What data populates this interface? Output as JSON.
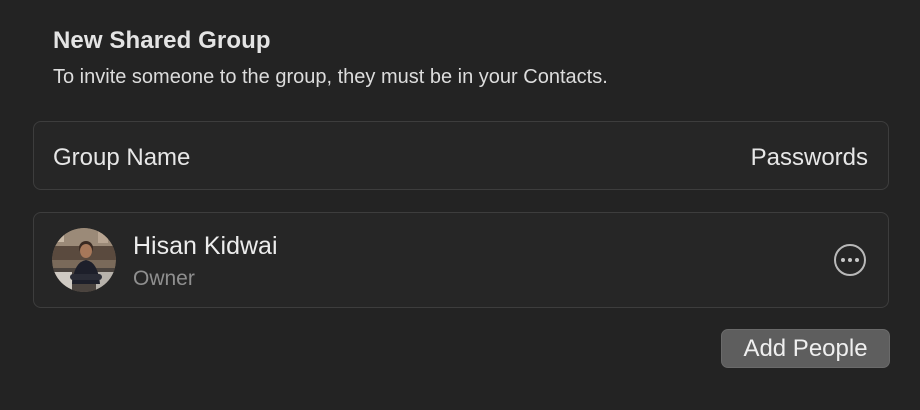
{
  "header": {
    "title": "New Shared Group",
    "subtitle": "To invite someone to the group, they must be in your Contacts."
  },
  "group_name": {
    "label": "Group Name",
    "value": "Passwords"
  },
  "members": [
    {
      "name": "Hisan Kidwai",
      "role": "Owner",
      "avatar_icon": "person-photo"
    }
  ],
  "actions": {
    "more_icon": "ellipsis-circle-icon",
    "add_people_label": "Add People"
  },
  "colors": {
    "background": "#232323",
    "card_background": "#262626",
    "card_border": "#3d3d3d",
    "button_background": "#5e5e5e",
    "secondary_text": "#8f8f8f"
  }
}
